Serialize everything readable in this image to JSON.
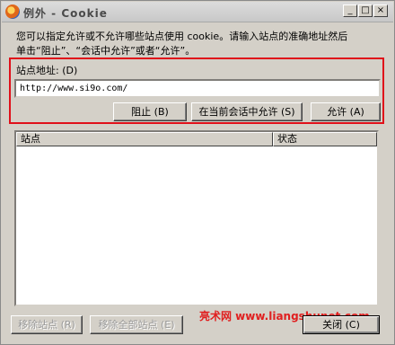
{
  "window": {
    "title": "例外 - Cookie",
    "controls": {
      "minimize": "_",
      "maximize": "□",
      "close": "×"
    }
  },
  "description": {
    "line1": "您可以指定允许或不允许哪些站点使用 cookie。请输入站点的准确地址然后",
    "line2": "单击“阻止”、“会话中允许”或者“允许”。"
  },
  "site": {
    "label": "站点地址: (D)",
    "value": "http://www.si9o.com/"
  },
  "buttons": {
    "block": "阻止 (B)",
    "session": "在当前会话中允许 (S)",
    "allow": "允许 (A)",
    "remove_site": "移除站点 (R)",
    "remove_all": "移除全部站点 (E)",
    "close": "关闭 (C)"
  },
  "list": {
    "columns": [
      "站点",
      "状态"
    ],
    "rows": []
  },
  "watermark": "亮术网 www.liangshunet.com"
}
